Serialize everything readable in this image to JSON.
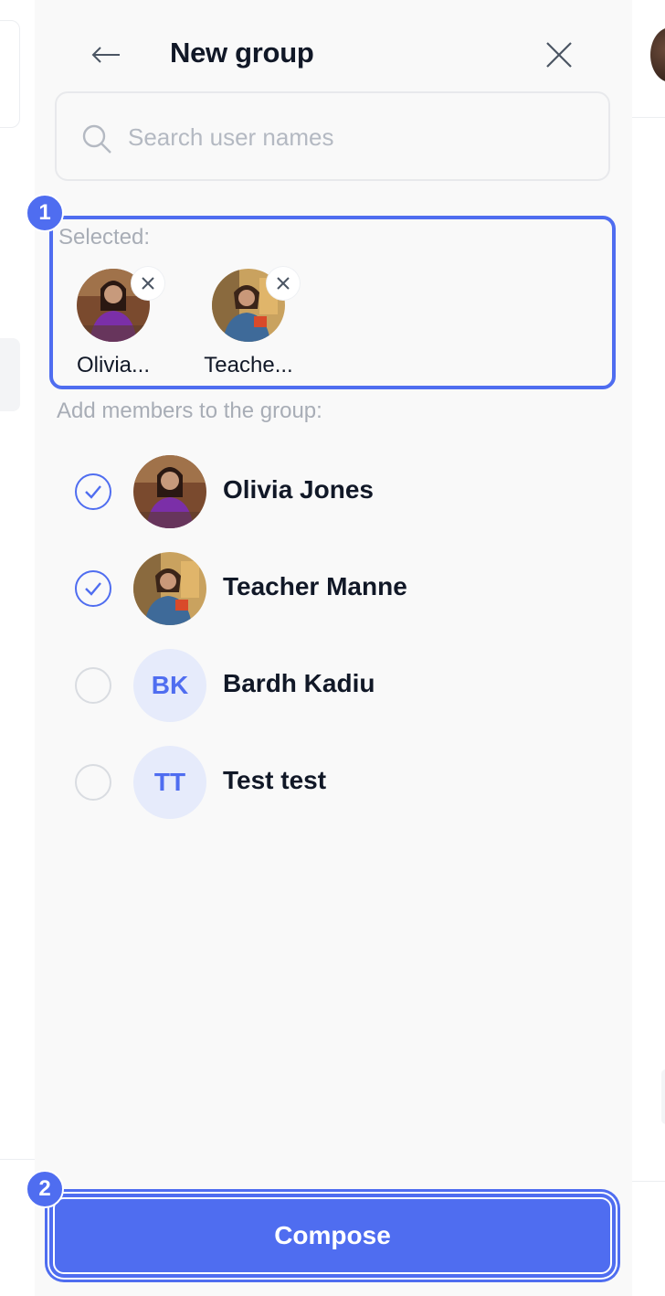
{
  "header": {
    "title": "New group",
    "back_icon": "arrow-left-icon",
    "close_icon": "close-icon"
  },
  "search": {
    "placeholder": "Search user names",
    "value": ""
  },
  "selected": {
    "label": "Selected:",
    "items": [
      {
        "name": "Olivia...",
        "avatar": "photo"
      },
      {
        "name": "Teache...",
        "avatar": "photo"
      }
    ]
  },
  "members": {
    "label": "Add members to the group:",
    "items": [
      {
        "name": "Olivia Jones",
        "checked": true,
        "avatar_type": "photo"
      },
      {
        "name": "Teacher Manne",
        "checked": true,
        "avatar_type": "photo"
      },
      {
        "name": "Bardh Kadiu",
        "checked": false,
        "avatar_type": "initials",
        "initials": "BK"
      },
      {
        "name": "Test test",
        "checked": false,
        "avatar_type": "initials",
        "initials": "TT"
      }
    ]
  },
  "compose": {
    "label": "Compose"
  },
  "annotations": {
    "badge_1": "1",
    "badge_2": "2"
  },
  "colors": {
    "accent": "#4f6df0",
    "panel_bg": "#f9f9f9",
    "muted_text": "#a8adb6",
    "initials_bg": "#e6ebfb"
  }
}
